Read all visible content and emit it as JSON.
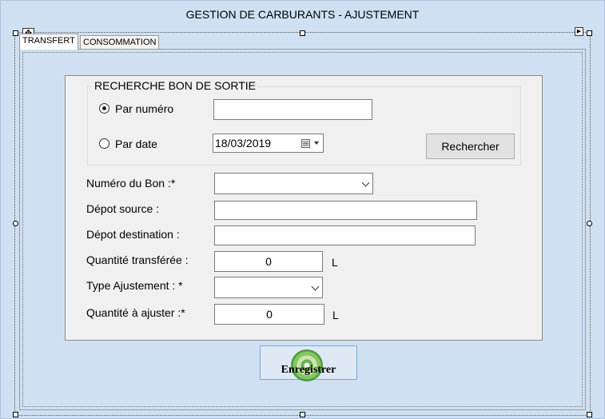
{
  "window": {
    "title": "GESTION DE CARBURANTS - AJUSTEMENT"
  },
  "tabs": [
    {
      "label": "TRANSFERT",
      "selected": true
    },
    {
      "label": "CONSOMMATION",
      "selected": false
    }
  ],
  "search": {
    "group_title": "RECHERCHE BON DE SORTIE",
    "by_number_label": "Par numéro",
    "by_number_selected": true,
    "number_value": "",
    "by_date_label": "Par date",
    "by_date_selected": false,
    "date_value": "18/03/2019",
    "search_button": "Rechercher"
  },
  "form": {
    "voucher_number_label": "Numéro du Bon :*",
    "voucher_number_value": "",
    "source_depot_label": "Dépot source :",
    "source_depot_value": "",
    "dest_depot_label": "Dépot destination :",
    "dest_depot_value": "",
    "transferred_qty_label": "Quantité transférée :",
    "transferred_qty_value": "0",
    "transferred_qty_unit": "L",
    "adjust_type_label": "Type Ajustement : *",
    "adjust_type_value": "",
    "adjust_qty_label": "Quantité à ajuster :*",
    "adjust_qty_value": "0",
    "adjust_qty_unit": "L"
  },
  "actions": {
    "save_label": "Enregistrer"
  }
}
